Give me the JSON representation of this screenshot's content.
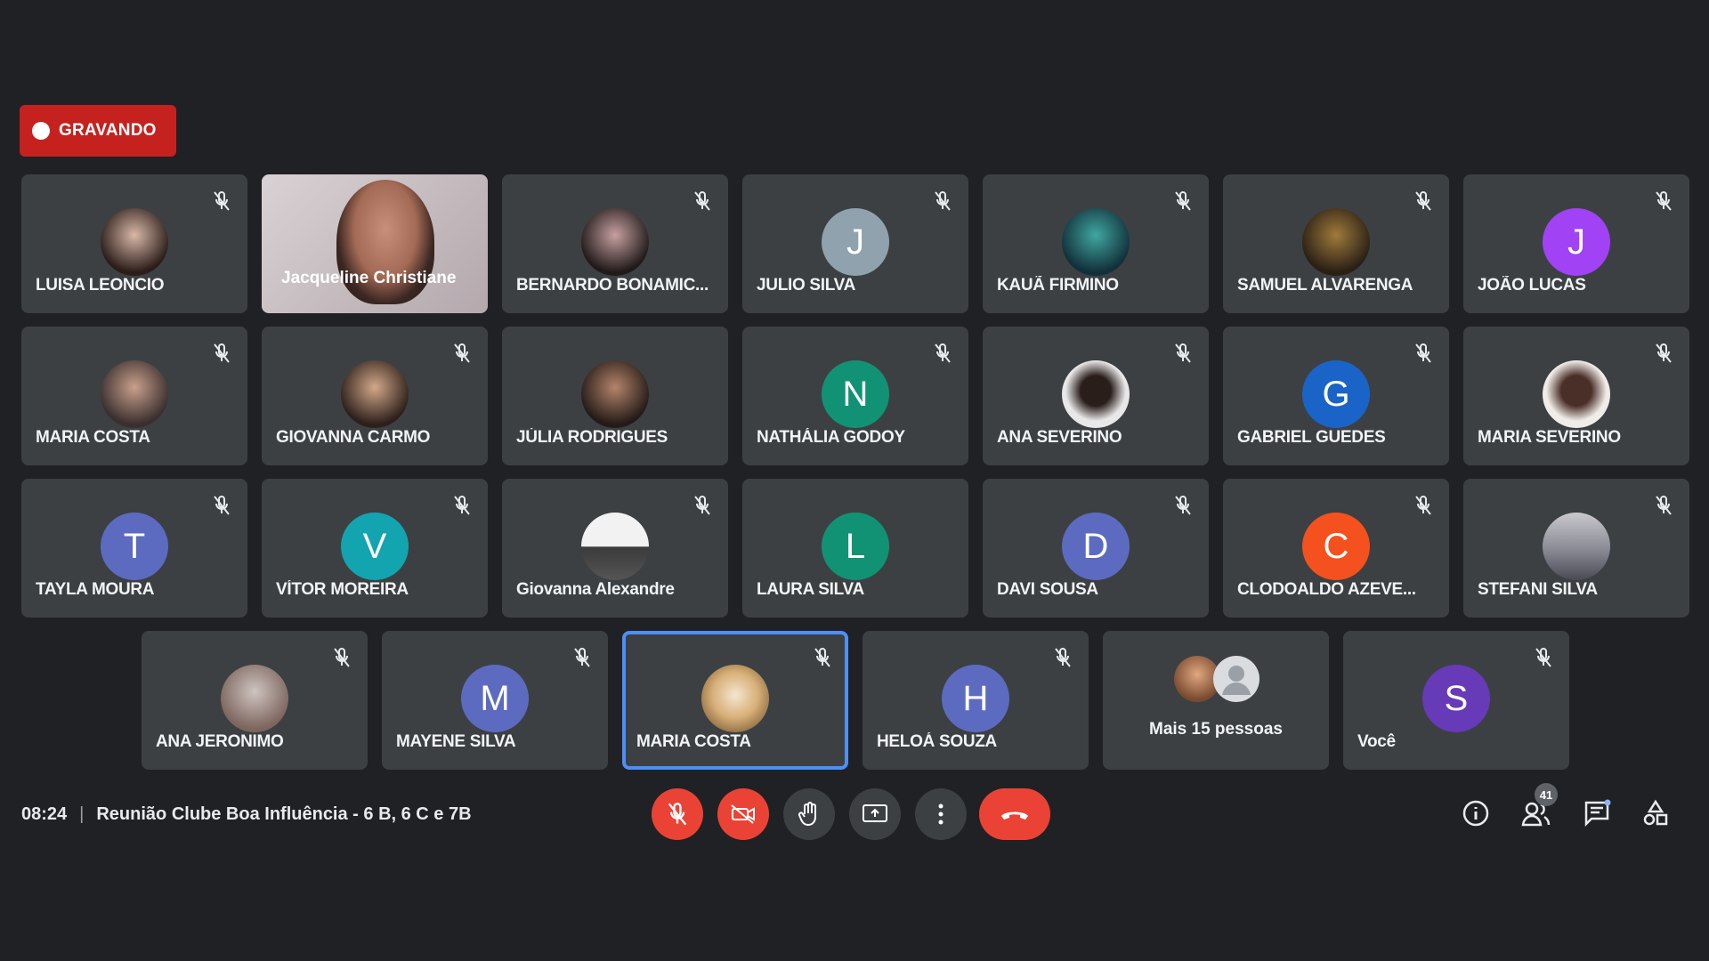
{
  "recording": {
    "label": "GRAVANDO",
    "color": "#c5221f"
  },
  "participants": [
    {
      "name": "LUISA LEONCIO",
      "type": "photo",
      "photo_colors": [
        "#2b1d1a",
        "#d9b8a8"
      ]
    },
    {
      "name": "Jacqueline Christiane",
      "type": "video"
    },
    {
      "name": "BERNARDO BONAMIC...",
      "type": "photo",
      "photo_colors": [
        "#211a1a",
        "#c7a0a0"
      ]
    },
    {
      "name": "JULIO SILVA",
      "type": "letter",
      "letter": "J",
      "color": "#8fa2ad"
    },
    {
      "name": "KAUÃ FIRMINO",
      "type": "photo",
      "photo_colors": [
        "#12303a",
        "#3fa7a0"
      ]
    },
    {
      "name": "SAMUEL ALVARENGA",
      "type": "photo",
      "photo_colors": [
        "#2a2016",
        "#a07a3a"
      ]
    },
    {
      "name": "JOÃO LUCAS",
      "type": "letter",
      "letter": "J",
      "color": "#a142f4"
    },
    {
      "name": "MARIA COSTA",
      "type": "photo",
      "photo_colors": [
        "#3a2f2f",
        "#c9a08a"
      ]
    },
    {
      "name": "GIOVANNA CARMO",
      "type": "photo",
      "photo_colors": [
        "#2d201b",
        "#d3a889"
      ]
    },
    {
      "name": "JÚLIA RODRIGUES",
      "type": "photo",
      "photo_colors": [
        "#241b18",
        "#b4846a"
      ]
    },
    {
      "name": "NATHÁLIA GODOY",
      "type": "letter",
      "letter": "N",
      "color": "#129274"
    },
    {
      "name": "ANA SEVERINO",
      "type": "photo",
      "photo_colors": [
        "#e8e8e8",
        "#2a1e1b"
      ]
    },
    {
      "name": "GABRIEL GUEDES",
      "type": "letter",
      "letter": "G",
      "color": "#1a64c8"
    },
    {
      "name": "MARIA SEVERINO",
      "type": "photo",
      "photo_colors": [
        "#f0ece8",
        "#4a2f28"
      ]
    },
    {
      "name": "TAYLA MOURA",
      "type": "letter",
      "letter": "T",
      "color": "#5c6bc0"
    },
    {
      "name": "VÍTOR MOREIRA",
      "type": "letter",
      "letter": "V",
      "color": "#12a4af"
    },
    {
      "name": "Giovanna Alexandre",
      "type": "photo",
      "photo_colors": [
        "#f2f2f2",
        "#3a3a3a"
      ]
    },
    {
      "name": "LAURA SILVA",
      "type": "letter",
      "letter": "L",
      "color": "#129274"
    },
    {
      "name": "DAVI SOUSA",
      "type": "letter",
      "letter": "D",
      "color": "#5c6bc0"
    },
    {
      "name": "CLODOALDO AZEVE...",
      "type": "letter",
      "letter": "C",
      "color": "#f4511e"
    },
    {
      "name": "STEFANI SILVA",
      "type": "photo",
      "photo_colors": [
        "#c8c8cc",
        "#4a4a55"
      ]
    },
    {
      "name": "ANA JERONIMO",
      "type": "photo",
      "photo_colors": [
        "#cfc4c0",
        "#7d665e"
      ]
    },
    {
      "name": "MAYENE SILVA",
      "type": "letter",
      "letter": "M",
      "color": "#5c6bc0"
    },
    {
      "name": "MARIA COSTA",
      "type": "photo",
      "photo_colors": [
        "#f5e6d0",
        "#8a6a40"
      ],
      "active": true
    },
    {
      "name": "HELOÁ SOUZA",
      "type": "letter",
      "letter": "H",
      "color": "#5c6bc0"
    },
    {
      "name": "Mais 15 pessoas",
      "type": "more"
    },
    {
      "name": "Você",
      "type": "letter",
      "letter": "S",
      "color": "#673ab7"
    }
  ],
  "meeting": {
    "time": "08:24",
    "separator": "|",
    "title": "Reunião Clube Boa Influência - 6 B, 6 C e 7B"
  },
  "controls": {
    "mic": "mic-off-icon",
    "camera": "camera-off-icon",
    "hand": "raise-hand-icon",
    "present": "present-screen-icon",
    "more": "more-options-icon",
    "leave": "end-call-icon"
  },
  "right_panel": {
    "info": "info-icon",
    "people": "people-icon",
    "people_count": "41",
    "chat": "chat-icon",
    "activities": "activities-icon"
  },
  "colors": {
    "background": "#202124",
    "tile": "#3c4043",
    "active_border": "#4d8ff8",
    "red": "#ea4335"
  }
}
